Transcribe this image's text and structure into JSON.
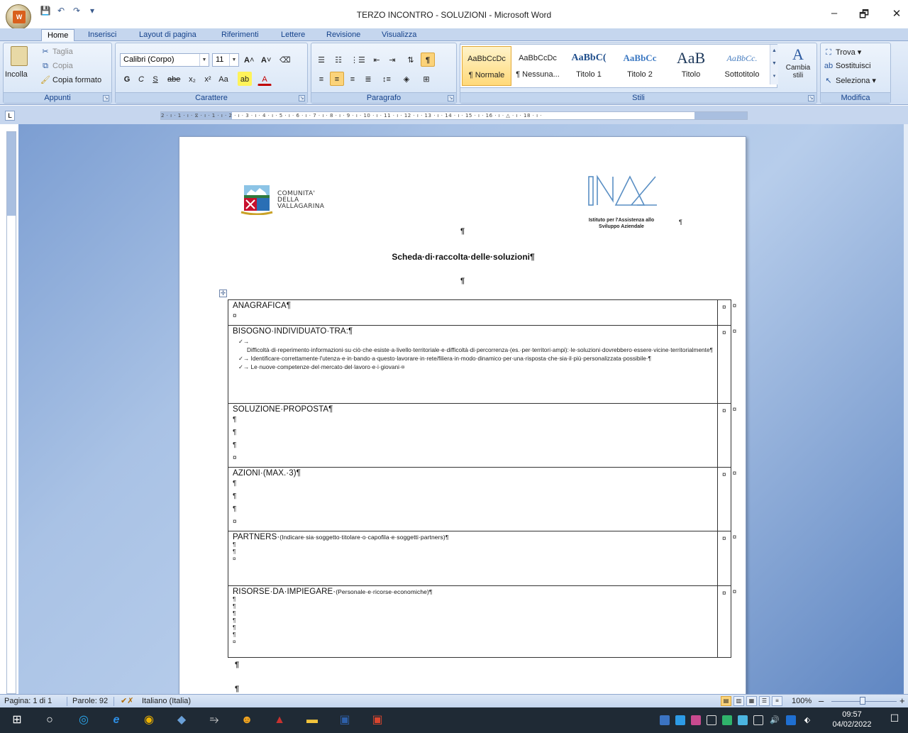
{
  "window": {
    "title": "TERZO INCONTRO - SOLUZIONI - Microsoft Word",
    "minimize": "–",
    "maximize": "🗗",
    "close": "✕"
  },
  "qat": {
    "save_icon": "💾",
    "undo_icon": "↶",
    "redo_icon": "↷",
    "more_icon": "▾"
  },
  "tabs": [
    "Home",
    "Inserisci",
    "Layout di pagina",
    "Riferimenti",
    "Lettere",
    "Revisione",
    "Visualizza"
  ],
  "ribbon": {
    "appunti": {
      "label": "Appunti",
      "paste": "Incolla",
      "cut": "Taglia",
      "copy": "Copia",
      "format_painter": "Copia formato"
    },
    "carattere": {
      "label": "Carattere",
      "font": "Calibri (Corpo)",
      "size": "11"
    },
    "paragrafo": {
      "label": "Paragrafo"
    },
    "stili": {
      "label": "Stili",
      "items": [
        {
          "sample": "AaBbCcDc",
          "name": "¶ Normale"
        },
        {
          "sample": "AaBbCcDc",
          "name": "¶ Nessuna..."
        },
        {
          "sample": "AaBbC(",
          "name": "Titolo 1"
        },
        {
          "sample": "AaBbCc",
          "name": "Titolo 2"
        },
        {
          "sample": "AaB",
          "name": "Titolo"
        },
        {
          "sample": "AaBbCc.",
          "name": "Sottotitolo"
        }
      ],
      "change": "Cambia stili"
    },
    "modifica": {
      "label": "Modifica",
      "find": "Trova",
      "replace": "Sostituisci",
      "select": "Seleziona"
    }
  },
  "ruler": {
    "corner": "L",
    "numbers": "2 · ı · 1 · ı · ⧖ · ı · 1 · ı · 2 · ı · 3 · ı · 4 · ı · 5 · ı · 6 · ı · 7 · ı · 8 · ı · 9 · ı · 10 · ı · 11 · ı · 12 · ı · 13 · ı · 14 · ı · 15 · ı · 16 · ı · △ · ı · 18 · ı ·"
  },
  "document": {
    "logo_left_text": [
      "COMUNITA'",
      "DELLA",
      "VALLAGARINA"
    ],
    "logo_right_text": [
      "Istituto per l'Assistenza allo",
      "Sviluppo Aziendale"
    ],
    "pilcrow": "¶",
    "cell_end": "¤",
    "title": "Scheda·di·raccolta·delle·soluzioni¶",
    "rows": [
      {
        "title": "ANAGRAFICA¶",
        "marks": [
          "¤"
        ]
      },
      {
        "title": "BISOGNO·INDIVIDUATO·TRA:¶",
        "bullets": [
          "✓→ Difficoltà·di·reperimento·informazioni·su·ciò·che·esiste·a·livello·territoriale·e·difficoltà·di·percorrenza·(es.·per·territori·ampi):·le·soluzioni·dovrebbero·essere·vicine·territorialmente¶",
          "✓→ Identificare·correttamente·l'utenza·e·in·bando·a·questo·lavorare·in·rete/filiera·in·modo·dinamico·per·una·risposta·che·sia·il·più·personalizzata·possibile·¶",
          "✓→ Le·nuove·competenze·del·mercato·del·lavoro·e·i·giovani·¤"
        ],
        "marks": []
      },
      {
        "title": "SOLUZIONE·PROPOSTA¶",
        "marks": [
          "¶",
          "¶",
          "¶",
          "¤"
        ]
      },
      {
        "title": "AZIONI·(MAX.·3)¶",
        "marks": [
          "¶",
          "¶",
          "¶",
          "¤"
        ]
      },
      {
        "title": "PARTNERS·",
        "title_small": "(Indicare·sia·soggetto·titolare·o·capofila·e·soggetti·partners)¶",
        "marks": [
          "¶",
          "¶",
          "¤"
        ],
        "small_marks": true
      },
      {
        "title": "RISORSE·DA·IMPIEGARE·",
        "title_small": "(Personale·e·ricorse·economiche)¶",
        "marks": [
          "¶",
          "¶",
          "¶",
          "¶",
          "¶",
          "¶",
          "¤"
        ],
        "small_marks": true
      }
    ]
  },
  "status": {
    "page": "Pagina: 1 di 1",
    "words": "Parole: 92",
    "language": "Italiano (Italia)",
    "zoom": "100%",
    "zoom_out": "–",
    "zoom_in": "+"
  },
  "taskbar": {
    "time": "09:57",
    "date": "04/02/2022"
  }
}
